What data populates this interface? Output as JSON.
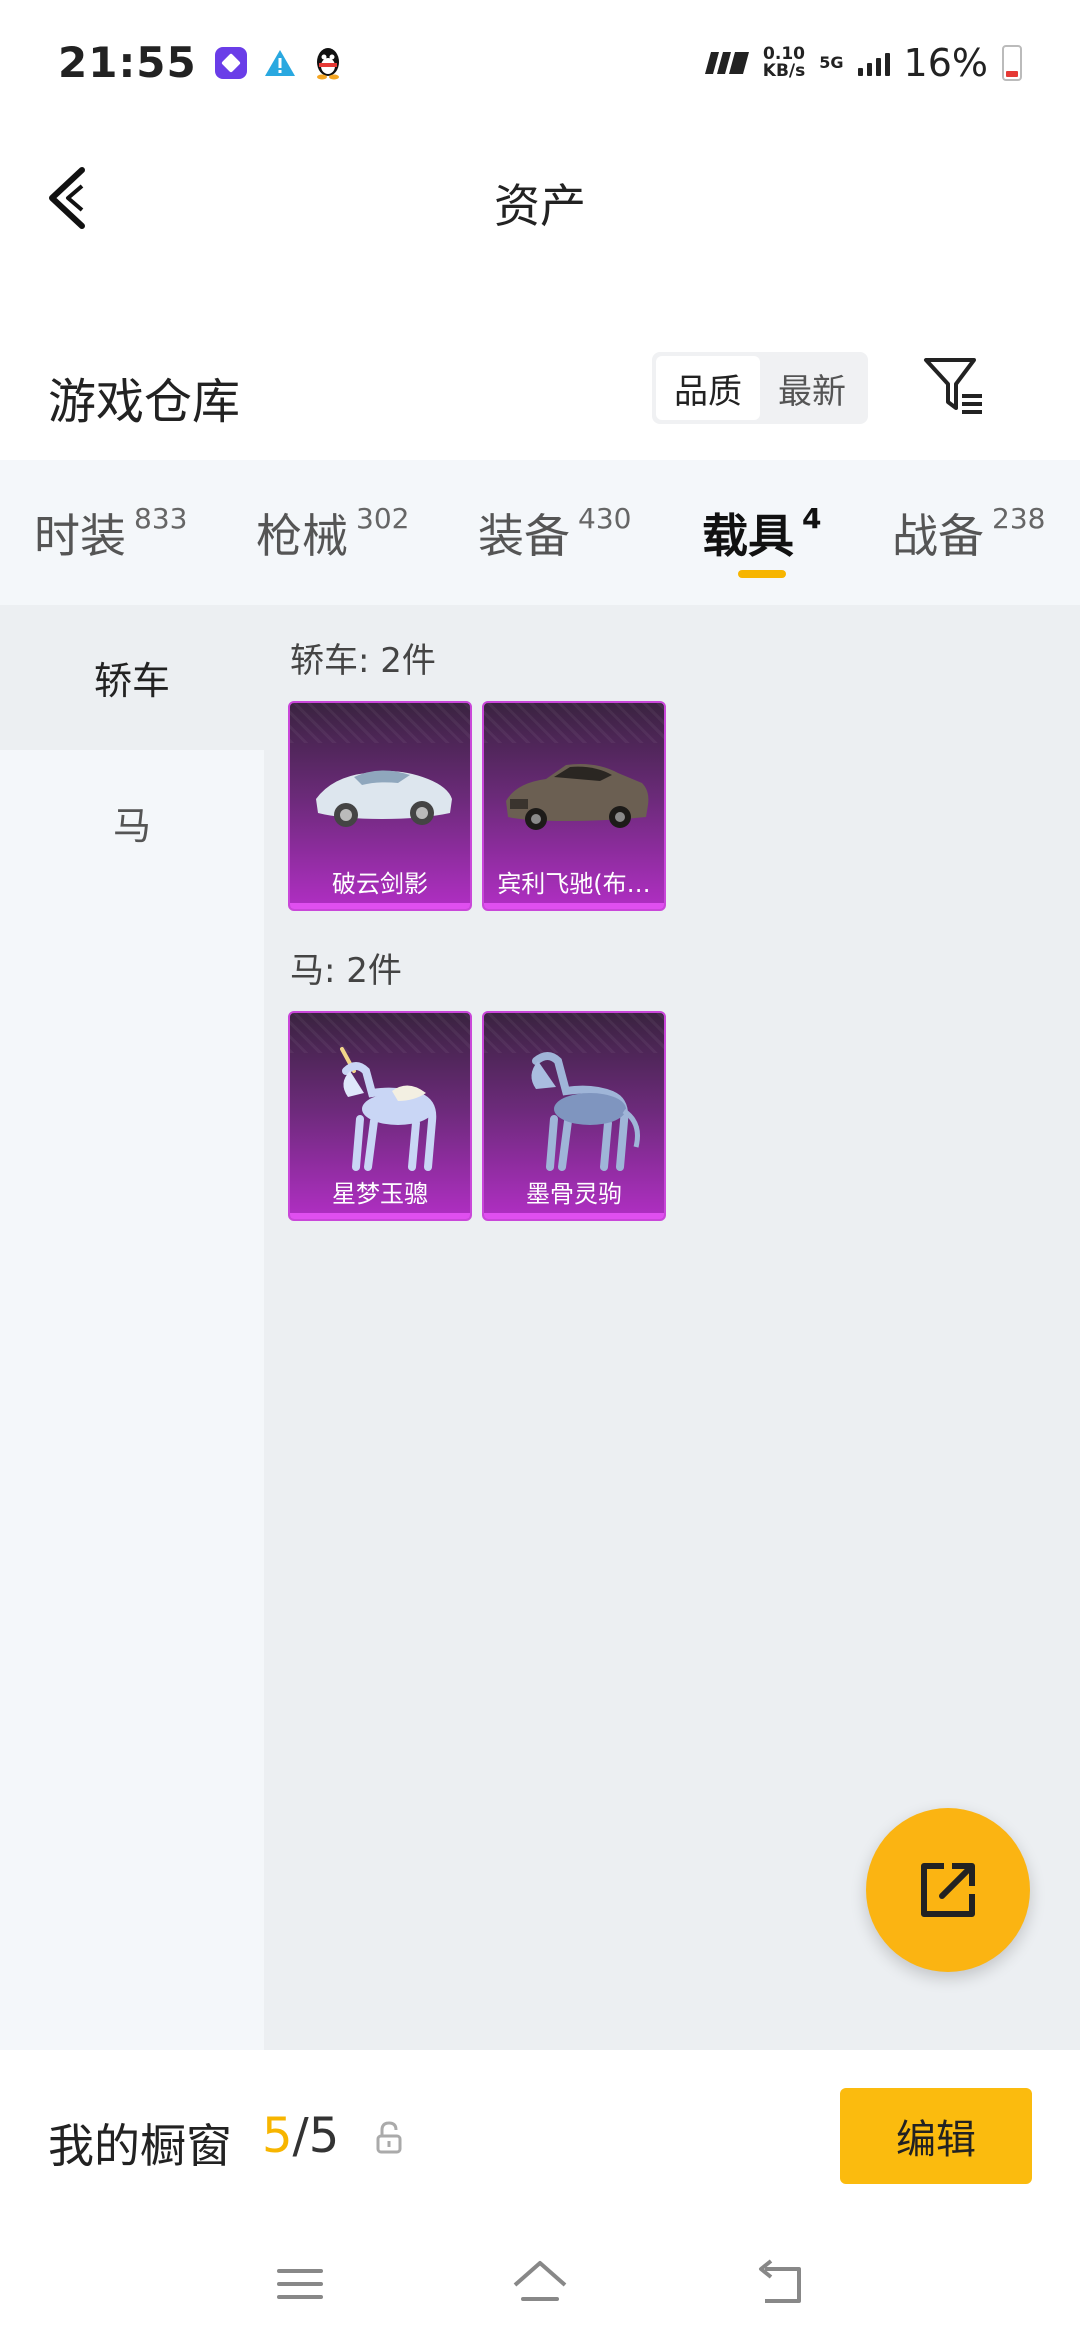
{
  "status_bar": {
    "time": "21:55",
    "speed_value": "0.10",
    "speed_unit": "KB/s",
    "network": "5G",
    "battery_percent": "16%",
    "battery_color": "#e53935"
  },
  "header": {
    "title": "资产",
    "back_icon": "chevron-left-icon"
  },
  "warehouse": {
    "title": "游戏仓库",
    "sort_options": [
      "品质",
      "最新"
    ],
    "sort_selected": "品质",
    "filter_icon": "filter-icon"
  },
  "tabs": [
    {
      "label": "时装",
      "count": "833"
    },
    {
      "label": "枪械",
      "count": "302"
    },
    {
      "label": "装备",
      "count": "430"
    },
    {
      "label": "载具",
      "count": "4",
      "active": true
    },
    {
      "label": "战备",
      "count": "238"
    }
  ],
  "sidebar": {
    "items": [
      {
        "label": "轿车",
        "active": true
      },
      {
        "label": "马"
      }
    ]
  },
  "sections": [
    {
      "title": "轿车: 2件",
      "items": [
        {
          "name": "破云剑影",
          "art": "sports-car-icon"
        },
        {
          "name": "宾利飞驰(布…",
          "art": "sedan-car-icon"
        }
      ]
    },
    {
      "title": "马: 2件",
      "items": [
        {
          "name": "星梦玉骢",
          "art": "unicorn-icon"
        },
        {
          "name": "墨骨灵驹",
          "art": "horse-icon"
        }
      ]
    }
  ],
  "share_fab": {
    "icon": "share-external-icon",
    "color": "#fbb412"
  },
  "showcase": {
    "title": "我的橱窗",
    "count_current": "5",
    "count_separator": "/",
    "count_total": "5",
    "lock_icon": "lock-icon",
    "edit_label": "编辑",
    "accent_color": "#f7b500"
  },
  "navbar": {
    "icons": [
      "menu-icon",
      "home-icon",
      "back-icon"
    ]
  }
}
